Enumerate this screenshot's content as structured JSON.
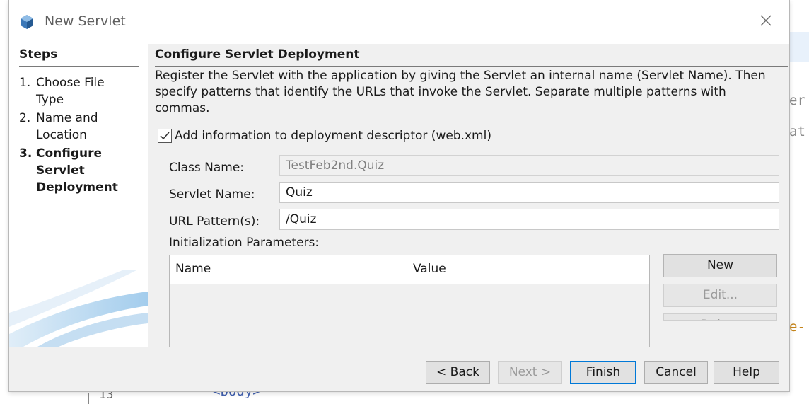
{
  "background": {
    "code_fragment_1": "er",
    "code_fragment_2": "at",
    "code_fragment_3": "e-",
    "code_fragment_4": "<body>",
    "line_number": "13"
  },
  "dialog": {
    "title": "New Servlet",
    "icon": "netbeans-cube-icon"
  },
  "steps": {
    "title": "Steps",
    "items": [
      {
        "num": "1.",
        "line1": "Choose File",
        "line2": "Type"
      },
      {
        "num": "2.",
        "line1": "Name and",
        "line2": "Location"
      },
      {
        "num": "3.",
        "line1": "Configure",
        "line2": "Servlet",
        "line3": "Deployment"
      }
    ]
  },
  "main": {
    "title": "Configure Servlet Deployment",
    "description": "Register the Servlet with the application by giving the Servlet an internal name (Servlet Name). Then specify patterns that identify the URLs that invoke the Servlet. Separate multiple patterns with commas.",
    "checkbox_label": "Add information to deployment descriptor (web.xml)",
    "checkbox_checked": true,
    "fields": {
      "class_name_label": "Class Name:",
      "class_name_value": "TestFeb2nd.Quiz",
      "servlet_name_label": "Servlet Name:",
      "servlet_name_value": "Quiz",
      "url_pattern_label": "URL Pattern(s):",
      "url_pattern_value": "/Quiz"
    },
    "init_params_label": "Initialization Parameters:",
    "table": {
      "col_name": "Name",
      "col_value": "Value"
    },
    "buttons": {
      "new": "New",
      "edit": "Edit...",
      "delete": "Delete"
    }
  },
  "footer": {
    "back": "< Back",
    "next": "Next >",
    "finish": "Finish",
    "cancel": "Cancel",
    "help": "Help"
  },
  "colors": {
    "accent": "#0078d7",
    "panel_bg": "#f0f0f0"
  }
}
